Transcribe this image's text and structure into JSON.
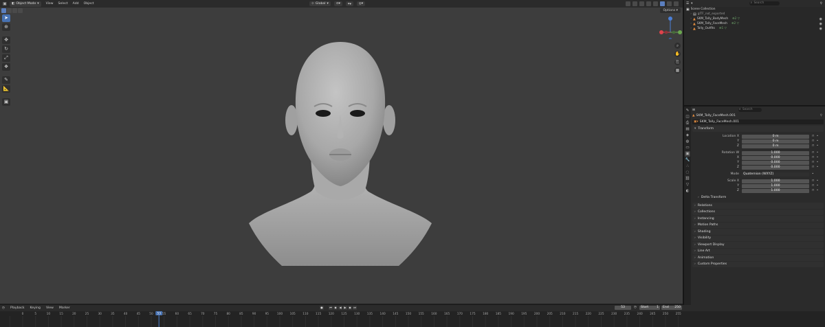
{
  "topbar": {
    "mode": "Object Mode",
    "menus": [
      "View",
      "Select",
      "Add",
      "Object"
    ],
    "orientation": "Global"
  },
  "viewport": {
    "options": "Options",
    "gizmo_axes": [
      "X",
      "Y",
      "Z"
    ]
  },
  "outliner": {
    "search_placeholder": "Search",
    "rows": [
      {
        "name": "Scene Collection",
        "type": "scene",
        "extra": ""
      },
      {
        "name": "glTF_not_exported",
        "type": "collection",
        "extra": ""
      },
      {
        "name": "SKM_Tally_BodyMesh",
        "type": "object",
        "extra": "⊕2 ▽"
      },
      {
        "name": "SKM_Tally_FaceMesh",
        "type": "object",
        "extra": "⊕2 ▽"
      },
      {
        "name": "Tally_Outfits",
        "type": "object",
        "extra": "⊕1 ▽"
      }
    ]
  },
  "properties": {
    "search_placeholder": "Search",
    "object_name": "SKM_Tally_FaceMesh.001",
    "data_name": "SKM_Tally_FaceMesh.001",
    "transform_title": "Transform",
    "rows": [
      {
        "label": "Location X",
        "value": "0 m"
      },
      {
        "label": "Y",
        "value": "0 m"
      },
      {
        "label": "Z",
        "value": "0 m"
      },
      {
        "label": "Rotation W",
        "value": "1.000"
      },
      {
        "label": "X",
        "value": "0.000"
      },
      {
        "label": "Y",
        "value": "0.000"
      },
      {
        "label": "Z",
        "value": "0.000"
      },
      {
        "label": "Mode",
        "value": "Quaternion (WXYZ)"
      },
      {
        "label": "Scale X",
        "value": "1.000"
      },
      {
        "label": "Y",
        "value": "1.000"
      },
      {
        "label": "Z",
        "value": "1.000"
      }
    ],
    "delta_transform": "Delta Transform",
    "panels": [
      "Relations",
      "Collections",
      "Instancing",
      "Motion Paths",
      "Shading",
      "Visibility",
      "Viewport Display",
      "Line Art",
      "Animation",
      "Custom Properties"
    ]
  },
  "timeline": {
    "menus": [
      "Playback",
      "Keying",
      "View",
      "Marker"
    ],
    "current_frame": "53",
    "start_label": "Start",
    "start_value": "1",
    "end_label": "End",
    "end_value": "250",
    "ruler_ticks": [
      "0",
      "5",
      "10",
      "15",
      "20",
      "25",
      "30",
      "35",
      "40",
      "45",
      "50",
      "53",
      "55",
      "60",
      "65",
      "70",
      "75",
      "80",
      "85",
      "90",
      "95",
      "100",
      "105",
      "110",
      "115",
      "120",
      "125",
      "130",
      "135",
      "140",
      "145",
      "150",
      "155",
      "160",
      "165",
      "170",
      "175",
      "180",
      "185",
      "190",
      "195",
      "200",
      "205",
      "210",
      "215",
      "220",
      "225",
      "230",
      "235",
      "240",
      "245",
      "250",
      "255"
    ]
  },
  "colors": {
    "accent": "#4772b3",
    "viewport_bg": "#3d3d3d",
    "axis_x": "#e0434c",
    "axis_y": "#6aa84f",
    "axis_z": "#4b7fd6"
  }
}
